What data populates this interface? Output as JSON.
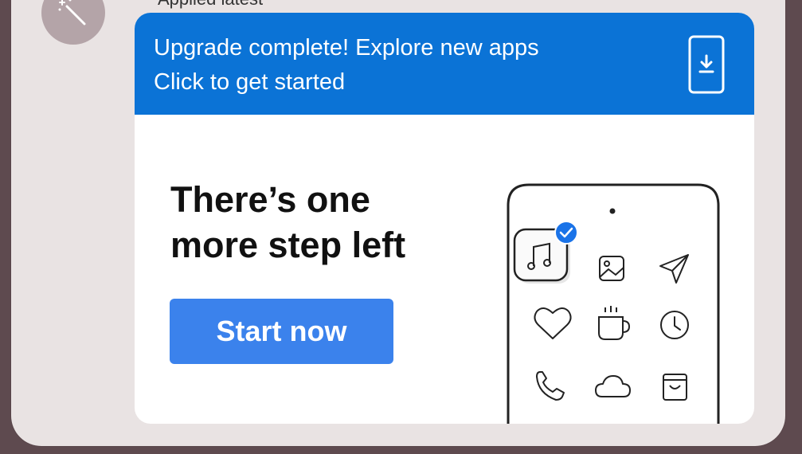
{
  "top_label": "Applied latest",
  "banner": {
    "title": "Upgrade complete! Explore new apps",
    "subtitle": "Click to get started",
    "icon": "phone-download-icon",
    "color": "#0b73d6"
  },
  "main": {
    "headline_line1": "There’s one",
    "headline_line2": "more step left",
    "start_button_label": "Start now",
    "button_color": "#3b82ec"
  },
  "illustration_icons": [
    "music-note-icon",
    "checkmark-badge-icon",
    "image-icon",
    "send-icon",
    "heart-icon",
    "coffee-cup-icon",
    "clock-icon",
    "phone-icon",
    "cloud-icon",
    "shopping-bag-icon"
  ]
}
